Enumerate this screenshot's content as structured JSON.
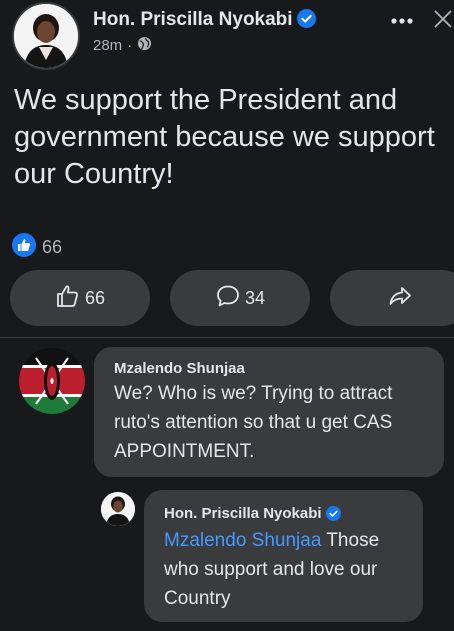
{
  "post": {
    "author": "Hon. Priscilla Nyokabi",
    "time": "28m",
    "separator": "·",
    "text": "We support the President and government because we support our Country!",
    "reaction_count": "66"
  },
  "actions": {
    "like_count": "66",
    "comment_count": "34"
  },
  "comments": [
    {
      "author": "Mzalendo Shunjaa",
      "text": "We? Who is we? Trying to attract ruto's attention so that u get CAS APPOINTMENT."
    }
  ],
  "reply": {
    "author": "Hon. Priscilla Nyokabi",
    "mention": "Mzalendo Shunjaa",
    "text": " Those who support and love our Country"
  },
  "icons": {
    "verified": "verified-badge-icon",
    "globe": "globe-icon",
    "more": "more-options-icon",
    "close": "close-icon",
    "like": "thumbs-up-icon",
    "comment": "comment-bubble-icon",
    "share": "share-arrow-icon"
  },
  "colors": {
    "background": "#18191a",
    "surface": "#3a3b3c",
    "accent": "#1877f2",
    "link": "#4599ff",
    "secondary_text": "#b0b3b8"
  }
}
